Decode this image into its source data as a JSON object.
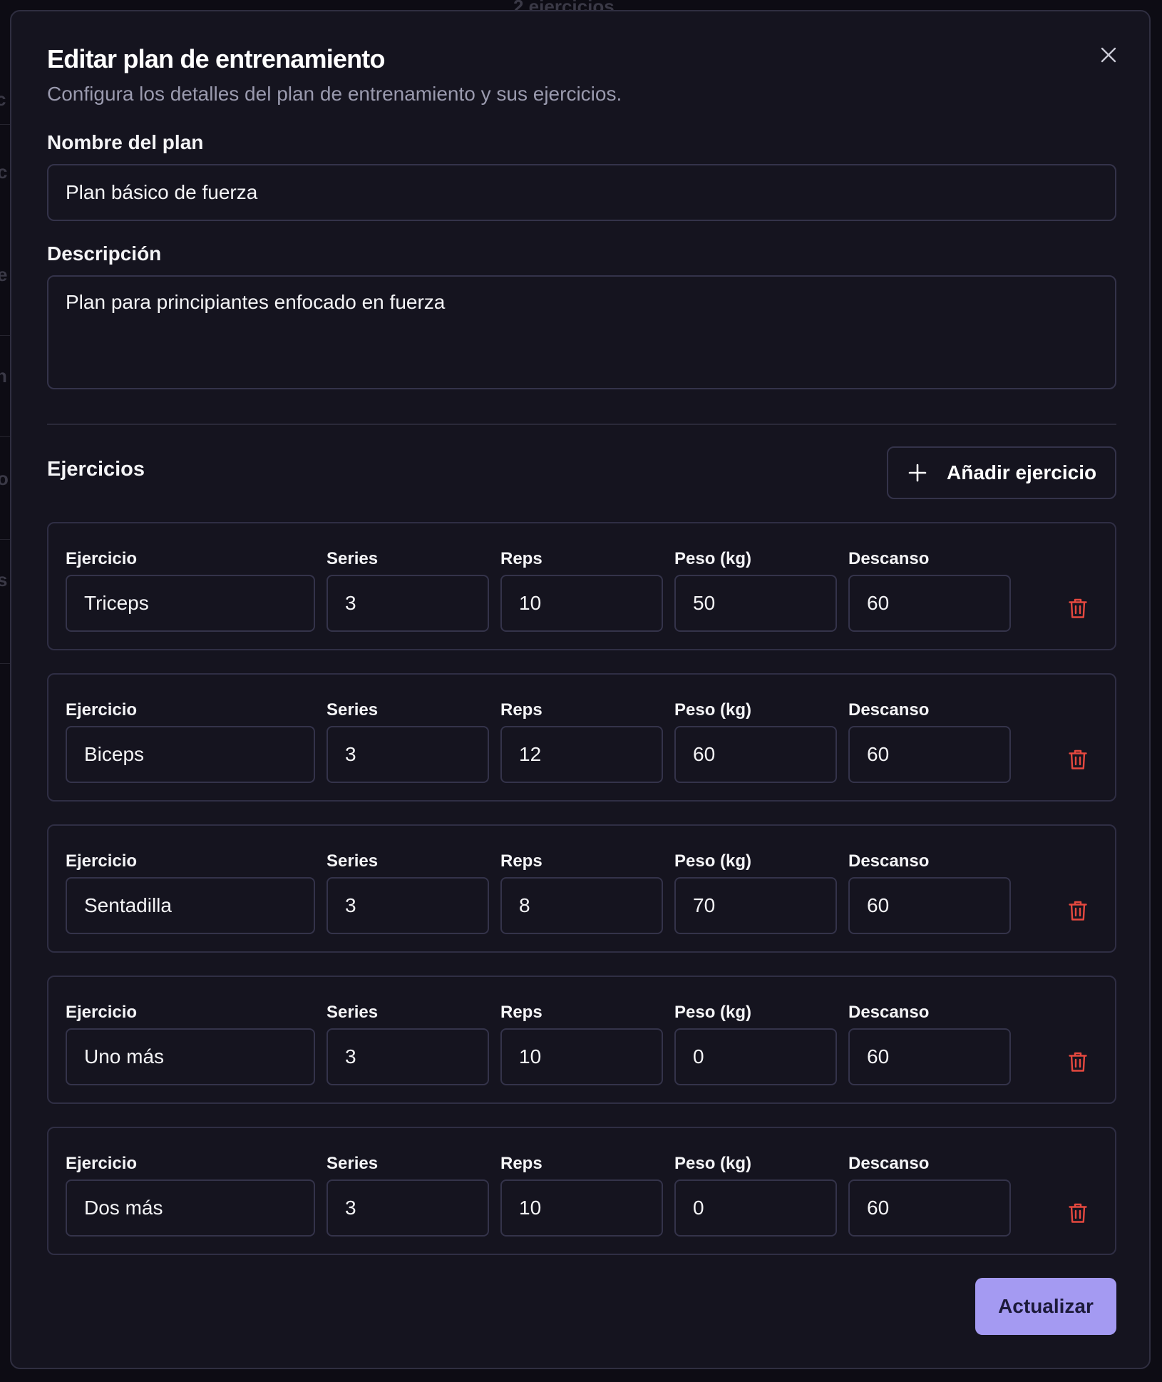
{
  "modal": {
    "title": "Editar plan de entrenamiento",
    "subtitle": "Configura los detalles del plan de entrenamiento y sus ejercicios.",
    "close_icon": "close-icon"
  },
  "form": {
    "name_label": "Nombre del plan",
    "name_value": "Plan básico de fuerza",
    "description_label": "Descripción",
    "description_value": "Plan para principiantes enfocado en fuerza"
  },
  "exercises_section": {
    "title": "Ejercicios",
    "add_button_label": "Añadir ejercicio",
    "add_icon": "plus-icon",
    "delete_icon": "trash-icon",
    "delete_color": "#e5483f",
    "column_labels": {
      "exercise": "Ejercicio",
      "series": "Series",
      "reps": "Reps",
      "weight": "Peso (kg)",
      "rest": "Descanso"
    },
    "items": [
      {
        "exercise": "Triceps",
        "series": "3",
        "reps": "10",
        "weight": "50",
        "rest": "60"
      },
      {
        "exercise": "Biceps",
        "series": "3",
        "reps": "12",
        "weight": "60",
        "rest": "60"
      },
      {
        "exercise": "Sentadilla",
        "series": "3",
        "reps": "8",
        "weight": "70",
        "rest": "60"
      },
      {
        "exercise": "Uno más",
        "series": "3",
        "reps": "10",
        "weight": "0",
        "rest": "60"
      },
      {
        "exercise": "Dos más",
        "series": "3",
        "reps": "10",
        "weight": "0",
        "rest": "60"
      }
    ]
  },
  "actions": {
    "submit_label": "Actualizar",
    "submit_color": "#a49af2"
  },
  "background": {
    "header_fragment": "2 ejercicios"
  }
}
